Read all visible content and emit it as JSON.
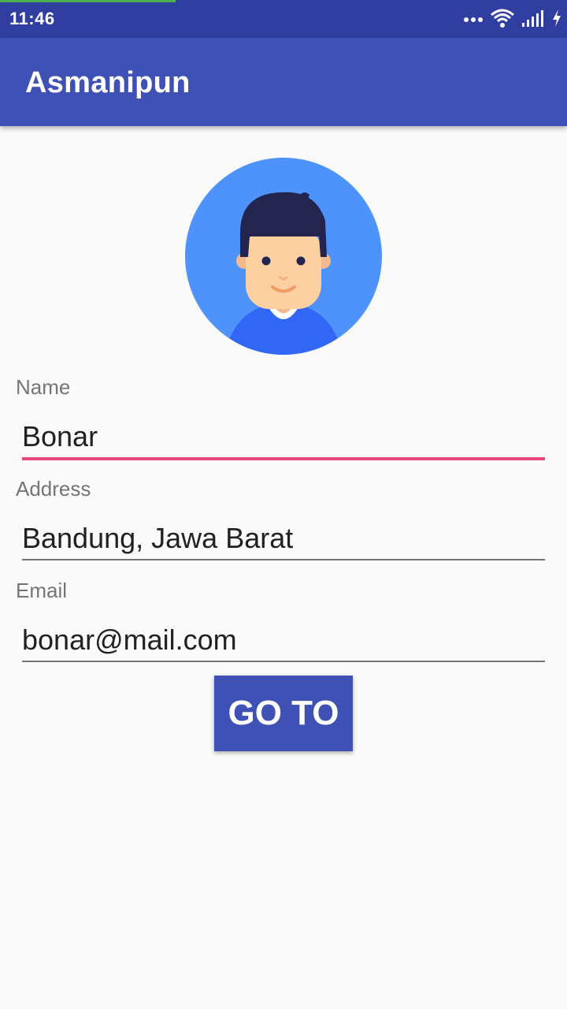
{
  "status_bar": {
    "time": "11:46",
    "progress": 0.31,
    "icons": [
      "more-dots-icon",
      "wifi-icon",
      "signal-icon",
      "charging-icon"
    ]
  },
  "app_bar": {
    "title": "Asmanipun"
  },
  "avatar": {
    "icon": "user-avatar-icon"
  },
  "form": {
    "name": {
      "label": "Name",
      "value": "Bonar"
    },
    "address": {
      "label": "Address",
      "value": "Bandung, Jawa Barat"
    },
    "email": {
      "label": "Email",
      "value": "bonar@mail.com"
    },
    "go_button_label": "GO TO"
  },
  "colors": {
    "status_bar": "#303f9f",
    "app_bar": "#3f51b5",
    "accent": "#e8457f",
    "button": "#3f51b5",
    "progress": "#4caf50"
  }
}
